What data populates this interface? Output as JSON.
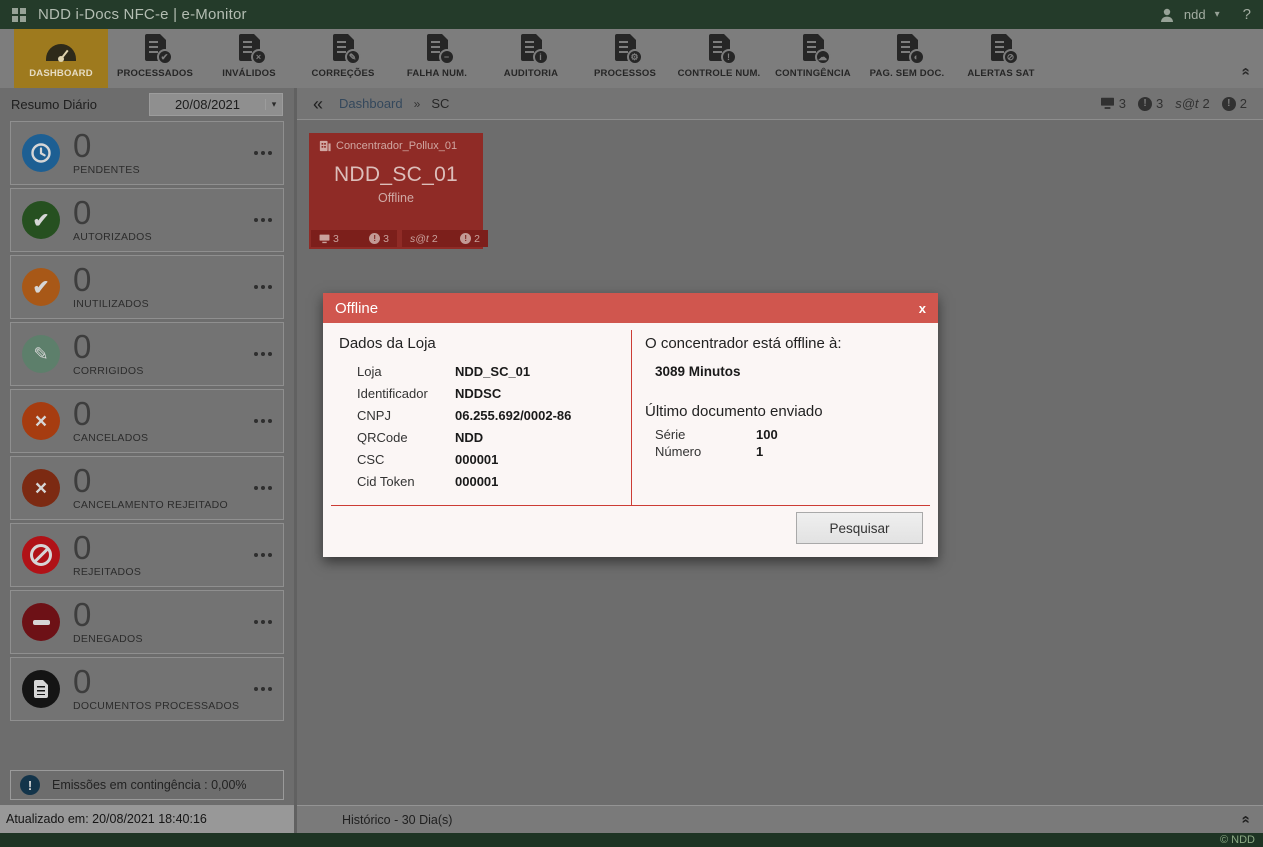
{
  "header": {
    "title": "NDD i-Docs NFC-e | e-Monitor",
    "user": "ndd",
    "help": "?"
  },
  "icons": {
    "alert_glyph": "!",
    "caret_down": "▾",
    "collapse_chevron": "»",
    "check": "✔",
    "pencil": "✎",
    "x_mark": "×"
  },
  "toolbar": {
    "items": [
      {
        "label": "DASHBOARD",
        "icon": "gauge-icon",
        "badge": ""
      },
      {
        "label": "PROCESSADOS",
        "icon": "doc-check-icon",
        "badge": "✔"
      },
      {
        "label": "INVÁLIDOS",
        "icon": "doc-x-icon",
        "badge": "×"
      },
      {
        "label": "CORREÇÕES",
        "icon": "doc-pencil-icon",
        "badge": "✎"
      },
      {
        "label": "FALHA NUM.",
        "icon": "doc-minus-icon",
        "badge": "−"
      },
      {
        "label": "AUDITORIA",
        "icon": "doc-info-icon",
        "badge": "i"
      },
      {
        "label": "PROCESSOS",
        "icon": "doc-gear-icon",
        "badge": "⚙"
      },
      {
        "label": "CONTROLE NUM.",
        "icon": "doc-alert-icon",
        "badge": "!"
      },
      {
        "label": "CONTINGÊNCIA",
        "icon": "doc-cloud-icon",
        "badge": "☁"
      },
      {
        "label": "PAG. SEM DOC.",
        "icon": "doc-half-icon",
        "badge": "◐"
      },
      {
        "label": "ALERTAS SAT",
        "icon": "doc-forbid-icon",
        "badge": "⊘"
      }
    ]
  },
  "breadcrumb": {
    "back": "«",
    "link": "Dashboard",
    "separator": "»",
    "current": "SC"
  },
  "status_badges": {
    "monitors": "3",
    "alerts": "3",
    "sat_label": "s@t",
    "sat_count": "2",
    "errors": "2"
  },
  "sidebar": {
    "summary_label": "Resumo Diário",
    "date_value": "20/08/2021",
    "cards": [
      {
        "label": "PENDENTES",
        "value": "0"
      },
      {
        "label": "AUTORIZADOS",
        "value": "0"
      },
      {
        "label": "INUTILIZADOS",
        "value": "0"
      },
      {
        "label": "CORRIGIDOS",
        "value": "0"
      },
      {
        "label": "CANCELADOS",
        "value": "0"
      },
      {
        "label": "CANCELAMENTO REJEITADO",
        "value": "0"
      },
      {
        "label": "REJEITADOS",
        "value": "0"
      },
      {
        "label": "DENEGADOS",
        "value": "0"
      },
      {
        "label": "DOCUMENTOS PROCESSADOS",
        "value": "0"
      }
    ],
    "contingency_text": "Emissões em contingência : 0,00%",
    "updated_text": "Atualizado em: 20/08/2021 18:40:16"
  },
  "tile": {
    "group": "Concentrador_Pollux_01",
    "name": "NDD_SC_01",
    "status": "Offline",
    "badges": {
      "monitors": "3",
      "alerts": "3",
      "sat_label": "s@t",
      "sat_count": "2",
      "errors": "2"
    }
  },
  "modal": {
    "title": "Offline",
    "close": "x",
    "store": {
      "heading": "Dados da Loja",
      "rows": [
        {
          "label": "Loja",
          "value": "NDD_SC_01"
        },
        {
          "label": "Identificador",
          "value": "NDDSC"
        },
        {
          "label": "CNPJ",
          "value": "06.255.692/0002-86"
        },
        {
          "label": "QRCode",
          "value": "NDD"
        },
        {
          "label": "CSC",
          "value": "000001"
        },
        {
          "label": "Cid Token",
          "value": "000001"
        }
      ]
    },
    "offline_info": {
      "heading": "O concentrador está offline à:",
      "minutes": "3089 Minutos",
      "last_doc_heading": "Último documento enviado",
      "rows": [
        {
          "label": "Série",
          "value": "100"
        },
        {
          "label": "Número",
          "value": "1"
        }
      ]
    },
    "search_button": "Pesquisar"
  },
  "history_bar": {
    "text": "Histórico - 30 Dia(s)"
  },
  "footer": {
    "copyright": "© NDD"
  }
}
